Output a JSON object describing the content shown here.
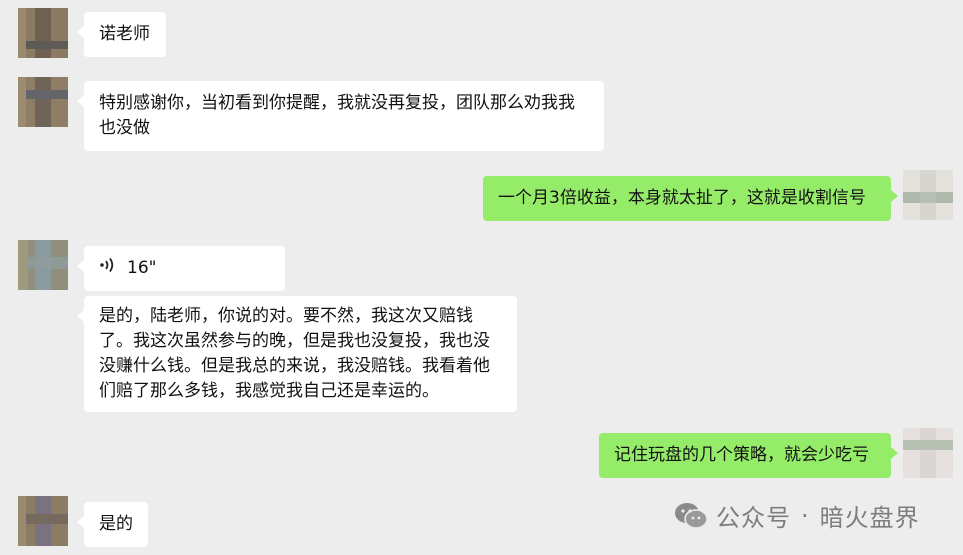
{
  "messages": [
    {
      "id": 1,
      "side": "left",
      "type": "text",
      "text": "诺老师"
    },
    {
      "id": 2,
      "side": "left",
      "type": "text",
      "text": "特别感谢你，当初看到你提醒，我就没再复投，团队那么劝我我也没做"
    },
    {
      "id": 3,
      "side": "right",
      "type": "text",
      "text": "一个月3倍收益，本身就太扯了，这就是收割信号"
    },
    {
      "id": 4,
      "side": "left",
      "type": "voice",
      "duration": "16\""
    },
    {
      "id": 5,
      "side": "left",
      "type": "text",
      "text": "是的，陆老师，你说的对。要不然，我这次又赔钱了。我这次虽然参与的晚，但是我也没复投，我也没没赚什么钱。但是我总的来说，我没赔钱。我看着他们赔了那么多钱，我感觉我自己还是幸运的。"
    },
    {
      "id": 6,
      "side": "right",
      "type": "text",
      "text": "记住玩盘的几个策略，就会少吃亏"
    },
    {
      "id": 7,
      "side": "left",
      "type": "text",
      "text": "是的"
    }
  ],
  "watermark": {
    "prefix": "公众号",
    "separator": "·",
    "account": "暗火盘界",
    "icon": "wechat-icon"
  },
  "colors": {
    "background": "#ededed",
    "incoming_bubble": "#ffffff",
    "outgoing_bubble": "#95ec69",
    "watermark": "#7d7d7d"
  }
}
